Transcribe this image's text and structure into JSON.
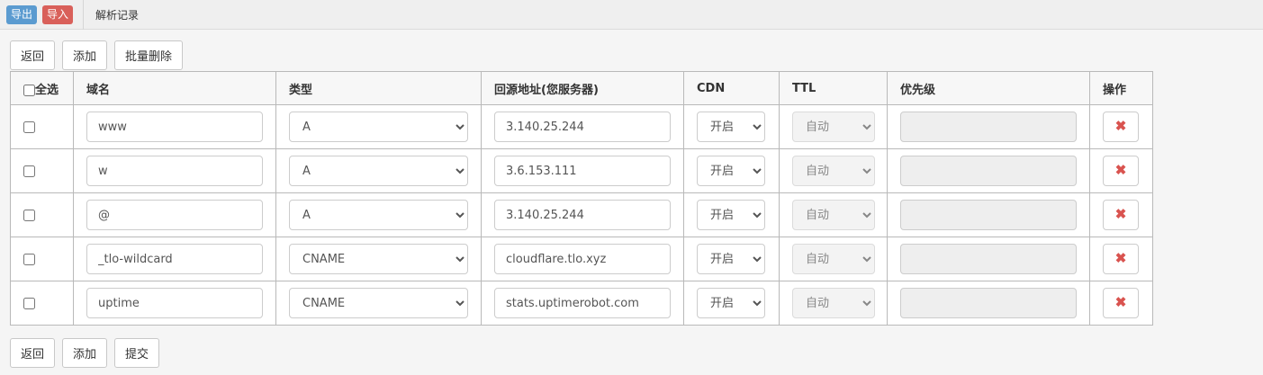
{
  "topbar": {
    "export_label": "导出",
    "import_label": "导入",
    "title": "解析记录"
  },
  "top_actions": {
    "back": "返回",
    "add": "添加",
    "batch_delete": "批量删除"
  },
  "bottom_actions": {
    "back": "返回",
    "add": "添加",
    "submit": "提交"
  },
  "table": {
    "headers": {
      "select_all": "全选",
      "domain": "域名",
      "type": "类型",
      "origin": "回源地址(您服务器)",
      "cdn": "CDN",
      "ttl": "TTL",
      "priority": "优先级",
      "action": "操作"
    },
    "rows": [
      {
        "domain": "www",
        "type": "A",
        "origin": "3.140.25.244",
        "cdn": "开启",
        "ttl": "自动",
        "priority": ""
      },
      {
        "domain": "w",
        "type": "A",
        "origin": "3.6.153.111",
        "cdn": "开启",
        "ttl": "自动",
        "priority": ""
      },
      {
        "domain": "@",
        "type": "A",
        "origin": "3.140.25.244",
        "cdn": "开启",
        "ttl": "自动",
        "priority": ""
      },
      {
        "domain": "_tlo-wildcard",
        "type": "CNAME",
        "origin": "cloudflare.tlo.xyz",
        "cdn": "开启",
        "ttl": "自动",
        "priority": ""
      },
      {
        "domain": "uptime",
        "type": "CNAME",
        "origin": "stats.uptimerobot.com",
        "cdn": "开启",
        "ttl": "自动",
        "priority": ""
      }
    ]
  },
  "icons": {
    "delete": "close-icon"
  },
  "colors": {
    "export": "#5b9bd0",
    "import": "#d9605a",
    "delete": "#d9534f"
  }
}
